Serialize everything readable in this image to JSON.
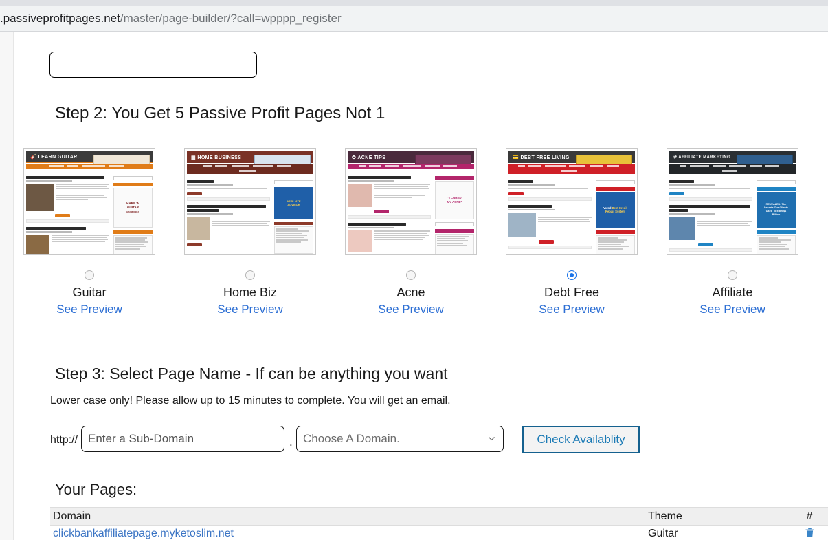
{
  "browser": {
    "url_dark": ".passiveprofitpages.net",
    "url_gray": "/master/page-builder/?call=wpppp_register"
  },
  "top_input": {
    "value": "",
    "placeholder": ""
  },
  "step2": {
    "heading": "Step 2: You Get 5 Passive Profit Pages Not 1",
    "themes": [
      {
        "label": "Guitar",
        "preview_link": "See Preview",
        "selected": false,
        "site_title": "LEARN GUITAR",
        "accent": "#e07c18",
        "header_bg": "#3b3b3b",
        "nav_bg": "#e07c18",
        "post1": "Elements on Learning and Mastering a Guitar",
        "post2": "Easily Learn to Play Electric Guitar",
        "sidebar_ad": "HARP 'N GUITAR.COM"
      },
      {
        "label": "Home Biz",
        "preview_link": "See Preview",
        "selected": false,
        "site_title": "HOME BUSINESS",
        "accent": "#8d3a2a",
        "header_bg": "#7a3226",
        "nav_bg": "#6d2b20",
        "post1": "Hello world!",
        "post2": "Utilize These Tips For Running A Home-Based Business",
        "sidebar_ad": "AFFILIATE ADVISOR"
      },
      {
        "label": "Acne",
        "preview_link": "See Preview",
        "selected": false,
        "site_title": "ACNE TIPS",
        "accent": "#b3256b",
        "header_bg": "#4a2a3c",
        "nav_bg": "#b3256b",
        "post1": "Treatment For The Acne Scars",
        "post2": "How to Effectively Treat Acne",
        "sidebar_ad": "I CURED MY ACNE"
      },
      {
        "label": "Debt Free",
        "preview_link": "See Preview",
        "selected": true,
        "site_title": "DEBT FREE LIVING",
        "accent": "#cf2027",
        "header_bg": "#3a3a3a",
        "nav_bg": "#cf2027",
        "post1": "Hello world!",
        "post2": "Free Debt Reduction",
        "sidebar_ad": "Voted Best Credit Repair System"
      },
      {
        "label": "Affiliate",
        "preview_link": "See Preview",
        "selected": false,
        "site_title": "AFFILIATE MARKETING",
        "accent": "#1f84c4",
        "header_bg": "#2a2f33",
        "nav_bg": "#222629",
        "post1": "Hello world!",
        "post2": "Outsourcing and Affiliate Sales, What you Need to Know",
        "sidebar_ad": "REVEALED: The Secrets Our Clients Used To Earn $1 Billion"
      }
    ]
  },
  "step3": {
    "heading": "Step 3: Select Page Name - If can be anything you want",
    "subtext": "Lower case only! Please allow up to 15 minutes to complete. You will get an email.",
    "http_label": "http://",
    "separator": ".",
    "subdomain_input": {
      "value": "",
      "placeholder": "Enter a Sub-Domain"
    },
    "domain_select": {
      "selected": "Choose A Domain.",
      "options": [
        "Choose A Domain."
      ]
    },
    "check_button": "Check Availablity"
  },
  "your_pages": {
    "heading": "Your Pages:",
    "columns": [
      "Domain",
      "Theme",
      "#"
    ],
    "rows": [
      {
        "domain": "clickbankaffiliatepage.myketoslim.net",
        "theme": "Guitar",
        "action": "trash-icon"
      }
    ]
  },
  "colors": {
    "link_blue": "#2d6fd4",
    "radio_selected": "#1a73e8",
    "button_border": "#15618f",
    "button_text": "#1b7ab5",
    "trash_icon": "#3a85c8"
  }
}
